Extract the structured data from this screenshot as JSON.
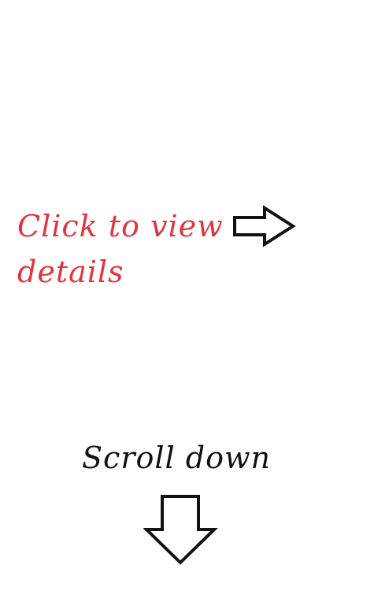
{
  "details_hint": {
    "label": "Click to view details",
    "color": "#e3343d",
    "icon": "right-arrow-icon"
  },
  "scroll_hint": {
    "label": "Scroll down",
    "color": "#111111",
    "icon": "down-arrow-icon"
  }
}
